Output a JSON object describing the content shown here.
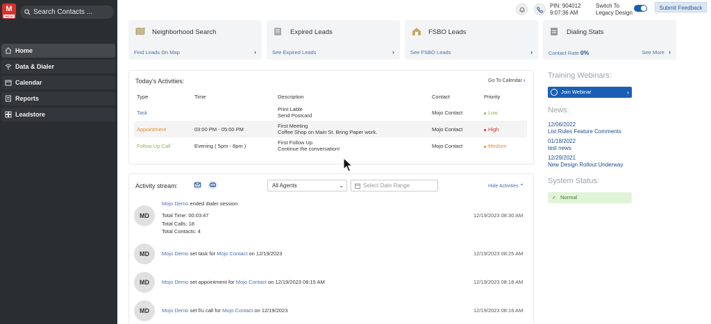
{
  "sidebar": {
    "logo_letter": "M",
    "logo_badge": "BETA",
    "search_placeholder": "Search Contacts ...",
    "items": [
      {
        "label": "Home",
        "icon": "home-icon"
      },
      {
        "label": "Data & Dialer",
        "icon": "wifi-icon"
      },
      {
        "label": "Calendar",
        "icon": "calendar-icon"
      },
      {
        "label": "Reports",
        "icon": "reports-icon"
      },
      {
        "label": "Leadstore",
        "icon": "store-icon"
      }
    ]
  },
  "topbar": {
    "pin_line1": "PIN: 904012",
    "pin_line2": "9:07:36 AM",
    "legacy_line1": "Switch To",
    "legacy_line2": "Legacy Design",
    "feedback": "Submit Feedback"
  },
  "cards": [
    {
      "title": "Neighborhood Search",
      "link": "Find Leads On Map"
    },
    {
      "title": "Expired Leads",
      "link": "See Expired Leads"
    },
    {
      "title": "FSBO Leads",
      "link": "See FSBO Leads"
    },
    {
      "title": "Dialing Stats",
      "link": "Contact Rate",
      "value": "0%",
      "more": "See More"
    }
  ],
  "activities": {
    "title": "Today's Activities:",
    "calendar_link": "Go To Calendar",
    "headers": [
      "Type",
      "Time",
      "Description",
      "Contact",
      "Priority"
    ],
    "rows": [
      {
        "type": "Task",
        "time": "",
        "desc_title": "Print Lable",
        "desc_sub": "Send Postcard",
        "contact": "Mojo Contact",
        "priority": "Low"
      },
      {
        "type": "Appointment",
        "time": "03:00 PM - 05:00 PM",
        "desc_title": "First Meeting",
        "desc_sub": "Coffee Shop on Main St. Bring Paper work.",
        "contact": "Mojo Contact",
        "priority": "High"
      },
      {
        "type": "Follow Up Call",
        "time": "Evening ( 5pm - 8pm )",
        "desc_title": "First Follow Up",
        "desc_sub": "Continue the conversation!",
        "contact": "Mojo Contact",
        "priority": "Medium"
      }
    ]
  },
  "stream": {
    "label": "Activity stream:",
    "agents": "All Agents",
    "date_placeholder": "Select Date Range",
    "hide": "Hide Activities",
    "events": [
      {
        "initials": "MD",
        "actor": "Mojo Demo",
        "text": " ended dialer session",
        "target": "",
        "suffix": "",
        "time": "12/19/2023 08:30 AM",
        "details": [
          "Total Time: 00:03:47",
          "Total Calls: 18",
          "Total Contacts: 4"
        ]
      },
      {
        "initials": "MD",
        "actor": "Mojo Demo",
        "text": " set task for ",
        "target": "Mojo Contact",
        "suffix": " on 12/19/2023",
        "time": "12/19/2023 08:25 AM"
      },
      {
        "initials": "MD",
        "actor": "Mojo Demo",
        "text": " set appointment for ",
        "target": "Mojo Contact",
        "suffix": " on 12/19/2023 08:15 AM",
        "time": "12/19/2023 08:18 AM"
      },
      {
        "initials": "MD",
        "actor": "Mojo Demo",
        "text": " set f/u call for ",
        "target": "Mojo Contact",
        "suffix": " on 12/19/2023",
        "time": "12/19/2023 08:16 AM"
      }
    ]
  },
  "right": {
    "training": "Training Webinars:",
    "webinar_btn": "Join Webinar",
    "news": "News:",
    "news_items": [
      {
        "date": "12/06/2022",
        "title": "List Rules Feature Comments"
      },
      {
        "date": "01/18/2022",
        "title": "test news"
      },
      {
        "date": "12/29/2021",
        "title": "New Design Rollout Underway"
      }
    ],
    "system_status": "System Status:",
    "status_value": "Normal"
  },
  "colors": {
    "accent": "#1a5fb4",
    "sidebar": "#2b2e31",
    "low": "#8db04b",
    "high": "#d9302c",
    "medium": "#e08a35"
  }
}
